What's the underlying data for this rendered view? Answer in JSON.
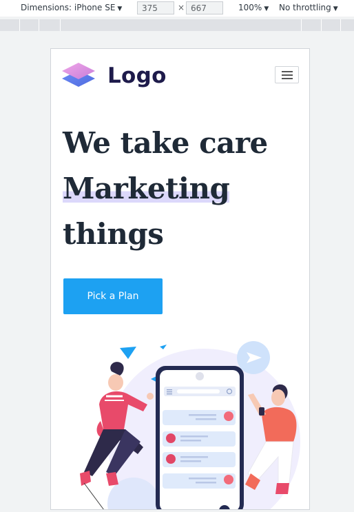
{
  "devtools": {
    "dimensions_label": "Dimensions: iPhone SE",
    "width": "375",
    "height": "667",
    "zoom": "100%",
    "throttling": "No throttling",
    "times": "×"
  },
  "site": {
    "logo_text": "Logo",
    "headline_line1": "We take care",
    "headline_line2": "Marketing",
    "headline_line3": "things",
    "cta_label": "Pick a Plan"
  },
  "colors": {
    "accent": "#1da1f2",
    "headline": "#1f2a37",
    "highlight": "#dcd8fb",
    "logo": "#1e1b4b"
  }
}
